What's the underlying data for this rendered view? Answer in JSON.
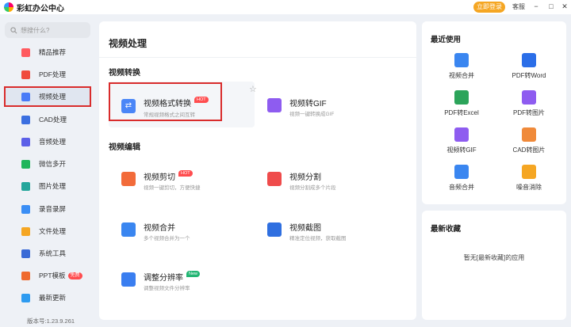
{
  "window": {
    "app_title": "彩虹办公中心",
    "login_label": "立即登录",
    "service_label": "客服",
    "minimize": "−",
    "maximize": "□",
    "close": "✕"
  },
  "sidebar": {
    "search_placeholder": "想搜什么?",
    "items": [
      {
        "label": "精品推荐",
        "icon": "gift-icon",
        "color": "#ff5a5f"
      },
      {
        "label": "PDF处理",
        "icon": "pdf-icon",
        "color": "#f04a3c"
      },
      {
        "label": "视频处理",
        "icon": "video-icon",
        "color": "#4a7bf7"
      },
      {
        "label": "CAD处理",
        "icon": "cad-icon",
        "color": "#3b6fe0"
      },
      {
        "label": "音频处理",
        "icon": "audio-icon",
        "color": "#5b5fe8"
      },
      {
        "label": "微信多开",
        "icon": "wechat-icon",
        "color": "#1fb55b"
      },
      {
        "label": "图片处理",
        "icon": "image-icon",
        "color": "#23a69b"
      },
      {
        "label": "录音录屏",
        "icon": "mic-icon",
        "color": "#3a8ef5"
      },
      {
        "label": "文件处理",
        "icon": "folder-icon",
        "color": "#f5a623"
      },
      {
        "label": "系统工具",
        "icon": "system-icon",
        "color": "#3a6ad6"
      },
      {
        "label": "PPT模板",
        "icon": "ppt-icon",
        "color": "#ef6a2e",
        "badge": "免费"
      },
      {
        "label": "最新更新",
        "icon": "update-icon",
        "color": "#2e9bf0"
      }
    ],
    "version": "版本号:1.23.9.261"
  },
  "main": {
    "title": "视频处理",
    "sections": [
      {
        "title": "视频转换",
        "tools": [
          {
            "name": "视频格式转换",
            "desc": "常规视频格式之间互转",
            "badge": "HOT",
            "icon": "format-convert-icon",
            "color": "#4a86f7"
          },
          {
            "name": "视频转GIF",
            "desc": "视频一键转换成GIF",
            "badge": "",
            "icon": "gif-icon",
            "color": "#8e5cf0"
          }
        ]
      },
      {
        "title": "视频编辑",
        "tools": [
          {
            "name": "视频剪切",
            "desc": "视频一键剪切，方便快捷",
            "badge": "HOT",
            "icon": "cut-icon",
            "color": "#f26b3a"
          },
          {
            "name": "视频分割",
            "desc": "视频分割成多个片段",
            "badge": "",
            "icon": "split-icon",
            "color": "#ef4b4b"
          },
          {
            "name": "视频合并",
            "desc": "多个视频合并为一个",
            "badge": "",
            "icon": "merge-icon",
            "color": "#3a86f0"
          },
          {
            "name": "视频截图",
            "desc": "精准定位视频，获取截图",
            "badge": "",
            "icon": "screenshot-icon",
            "color": "#2f6fe0"
          },
          {
            "name": "调整分辨率",
            "desc": "调整视频文件分辨率",
            "badge": "New",
            "icon": "resolution-icon",
            "color": "#3a7ef0"
          }
        ]
      }
    ]
  },
  "recent": {
    "title": "最近使用",
    "items": [
      {
        "label": "视频合并",
        "icon": "merge-icon",
        "color": "#3a86f0"
      },
      {
        "label": "PDF转Word",
        "icon": "word-icon",
        "color": "#2b6ee8"
      },
      {
        "label": "PDF转Excel",
        "icon": "excel-icon",
        "color": "#2ca45a"
      },
      {
        "label": "PDF转图片",
        "icon": "pdf-image-icon",
        "color": "#8e5cf0"
      },
      {
        "label": "视频转GIF",
        "icon": "gif-icon",
        "color": "#8e5cf0"
      },
      {
        "label": "CAD转图片",
        "icon": "cad-image-icon",
        "color": "#f08a3a"
      },
      {
        "label": "音频合并",
        "icon": "audio-merge-icon",
        "color": "#3a86f0"
      },
      {
        "label": "噪音消除",
        "icon": "noise-icon",
        "color": "#f5a623"
      }
    ]
  },
  "favorites": {
    "title": "最新收藏",
    "empty_text": "暂无[最新收藏]的应用"
  }
}
